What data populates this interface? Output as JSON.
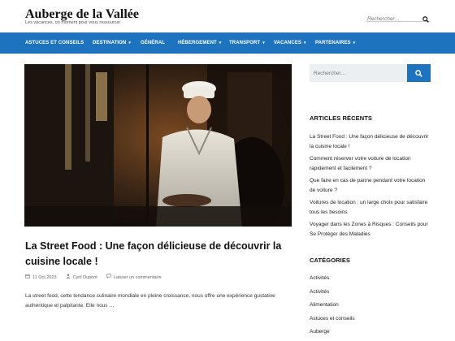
{
  "site": {
    "title": "Auberge de la Vallée",
    "tagline": "Les vacances, un moment pour vous ressourcer"
  },
  "header_search": {
    "placeholder": "Rechercher…",
    "icon": "search-icon"
  },
  "nav": {
    "background": "#1e73be",
    "items": [
      {
        "label": "Astuces et conseils",
        "has_submenu": false
      },
      {
        "label": "Destination",
        "has_submenu": true
      },
      {
        "label": "Général",
        "has_submenu": false
      },
      {
        "label": "Hébergement",
        "has_submenu": true
      },
      {
        "label": "Transport",
        "has_submenu": true
      },
      {
        "label": "Vacances",
        "has_submenu": true
      },
      {
        "label": "Partenaires",
        "has_submenu": true
      }
    ]
  },
  "post": {
    "title": "La Street Food : Une façon délicieuse de découvrir la cuisine locale !",
    "date": "11 Oct,2023",
    "author": "Cyril Dupont",
    "comment_link": "Laisser un commentaire",
    "excerpt": "La street food, cette tendance culinaire mondiale en pleine croissance, nous offre une expérience gustative authentique et palpitante. Elle nous …"
  },
  "sidebar": {
    "search_placeholder": "Rechercher…",
    "recent_title": "ARTICLES RÉCENTS",
    "recent": [
      "La Street Food : Une façon délicieuse de découvrir la cuisine locale !",
      "Comment réserver votre voiture de location rapidement et facilement ?",
      "Que faire en cas de panne pendant votre location de voiture ?",
      "Voitures de location : un large choix pour satisfaire tous les besoins",
      "Voyager dans les Zones à Risques : Conseils pour Se Protéger des Maladies"
    ],
    "categories_title": "CATÉGORIES",
    "categories": [
      "Activités",
      "Activités",
      "Alimentation",
      "Astuces et conseils",
      "Auberge"
    ]
  }
}
